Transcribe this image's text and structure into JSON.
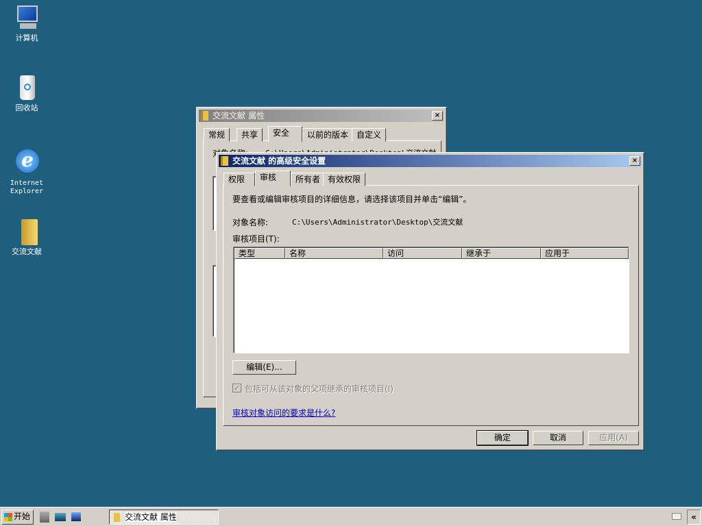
{
  "desktop": {
    "icons": [
      {
        "label": "计算机",
        "icon": "computer-icon"
      },
      {
        "label": "回收站",
        "icon": "recycle-bin-icon"
      },
      {
        "label": "Internet Explorer",
        "icon": "internet-explorer-icon"
      },
      {
        "label": "交流文献",
        "icon": "folder-icon"
      }
    ]
  },
  "properties_window": {
    "title": "交流文献 属性",
    "close": "×",
    "tabs": [
      "常规",
      "共享",
      "安全",
      "以前的版本",
      "自定义"
    ],
    "selected_tab": "安全",
    "object_name_label": "对象名称:",
    "object_name_value": "C:\\Users\\Administrator\\Desktop\\交流文献"
  },
  "advanced_window": {
    "title": "交流文献 的高级安全设置",
    "close": "×",
    "tabs": [
      "权限",
      "审核",
      "所有者",
      "有效权限"
    ],
    "selected_tab": "审核",
    "instruction": "要查看或编辑审核项目的详细信息，请选择该项目并单击“编辑”。",
    "object_name_label": "对象名称:",
    "object_name_value": "C:\\Users\\Administrator\\Desktop\\交流文献",
    "audit_entries_label": "审核项目(T):",
    "columns": [
      "类型",
      "名称",
      "访问",
      "继承于",
      "应用于"
    ],
    "rows": [],
    "edit_button": "编辑(E)...",
    "inherit_checkbox": {
      "label": "包括可从该对象的父项继承的审核项目(I)",
      "checked": true,
      "disabled": true
    },
    "help_link": "审核对象访问的要求是什么?",
    "ok": "确定",
    "cancel": "取消",
    "apply": "应用(A)"
  },
  "taskbar": {
    "start": "开始",
    "task": "交流文献 属性",
    "show_hidden": "«"
  }
}
